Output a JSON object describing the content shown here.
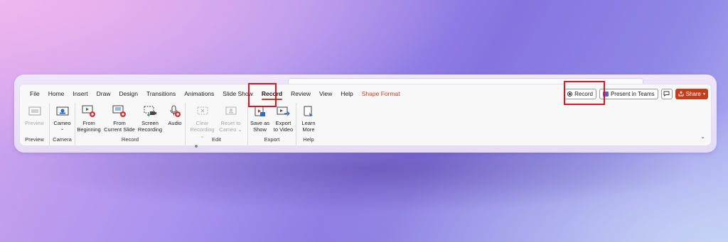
{
  "tabs": [
    {
      "label": "File"
    },
    {
      "label": "Home"
    },
    {
      "label": "Insert"
    },
    {
      "label": "Draw"
    },
    {
      "label": "Design"
    },
    {
      "label": "Transitions"
    },
    {
      "label": "Animations"
    },
    {
      "label": "Slide Show"
    },
    {
      "label": "Record",
      "active": true
    },
    {
      "label": "Review"
    },
    {
      "label": "View"
    },
    {
      "label": "Help"
    },
    {
      "label": "Shape Format",
      "contextual": true
    }
  ],
  "right": {
    "record_label": "Record",
    "present_label": "Present in Teams",
    "share_label": "Share"
  },
  "groups": {
    "preview": {
      "label": "Preview",
      "preview_btn": "Preview"
    },
    "camera": {
      "label": "Camera",
      "cameo_btn": "Cameo"
    },
    "record": {
      "label": "Record",
      "from_beginning_1": "From",
      "from_beginning_2": "Beginning",
      "from_current_1": "From",
      "from_current_2": "Current Slide",
      "screen_1": "Screen",
      "screen_2": "Recording",
      "audio": "Audio"
    },
    "edit": {
      "label": "Edit",
      "clear_1": "Clear",
      "clear_2": "Recording",
      "reset_1": "Reset to",
      "reset_2": "Cameo"
    },
    "export": {
      "label": "Export",
      "save_show_1": "Save as",
      "save_show_2": "Show",
      "export_video_1": "Export",
      "export_video_2": "to Video"
    },
    "help": {
      "label": "Help",
      "learn_1": "Learn",
      "learn_2": "More"
    }
  },
  "colors": {
    "accent": "#c43e1c",
    "highlight": "#e0141e",
    "teams": "#5b5fc7"
  }
}
